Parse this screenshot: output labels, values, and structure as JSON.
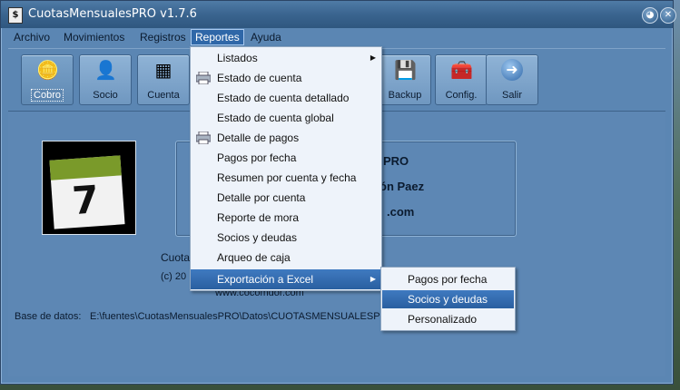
{
  "window": {
    "title": "CuotasMensualesPRO v1.7.6",
    "app_icon_char": "$"
  },
  "menubar": {
    "items": [
      {
        "label": "Archivo"
      },
      {
        "label": "Movimientos"
      },
      {
        "label": "Registros"
      },
      {
        "label": "Reportes"
      },
      {
        "label": "Ayuda"
      }
    ]
  },
  "toolbar": {
    "buttons": [
      {
        "label": "Cobro",
        "icon": "coins-hand-icon"
      },
      {
        "label": "Socio",
        "icon": "add-user-icon"
      },
      {
        "label": "Cuenta",
        "icon": "add-sheet-icon"
      },
      {
        "label": "Backup",
        "icon": "floppy-icon"
      },
      {
        "label": "Config.",
        "icon": "toolbox-icon"
      },
      {
        "label": "Salir",
        "icon": "exit-arrow-icon"
      }
    ]
  },
  "content": {
    "info_line_1_partial": "PRO",
    "info_line_2_partial": "ón Paez",
    "info_line_3_partial": ".com",
    "author_partial": "Cuota",
    "copyright_partial": "(c) 20",
    "website_partial": "www.cocomdor.com",
    "db_label": "Base de datos:",
    "db_path": "E:\\fuentes\\CuotasMensualesPRO\\Datos\\CUOTASMENSUALESPRO."
  },
  "reportes_menu": {
    "items": [
      {
        "label": "Listados",
        "has_submenu": true
      },
      {
        "label": "Estado de cuenta",
        "icon": "printer-icon"
      },
      {
        "label": "Estado de cuenta detallado"
      },
      {
        "label": "Estado de cuenta global"
      },
      {
        "label": "Detalle de pagos",
        "icon": "printer-icon"
      },
      {
        "label": "Pagos por fecha"
      },
      {
        "label": "Resumen por cuenta y fecha"
      },
      {
        "label": "Detalle por cuenta"
      },
      {
        "label": "Reporte de mora"
      },
      {
        "label": "Socios y deudas"
      },
      {
        "label": "Arqueo de caja"
      },
      {
        "label": "Exportación a Excel",
        "has_submenu": true
      }
    ]
  },
  "export_submenu": {
    "items": [
      {
        "label": "Pagos por fecha"
      },
      {
        "label": "Socios y deudas"
      },
      {
        "label": "Personalizado"
      }
    ]
  },
  "colors": {
    "accent": "#2f67a8",
    "window_bg": "#5b86b3",
    "menu_bg": "#eef3fa"
  }
}
